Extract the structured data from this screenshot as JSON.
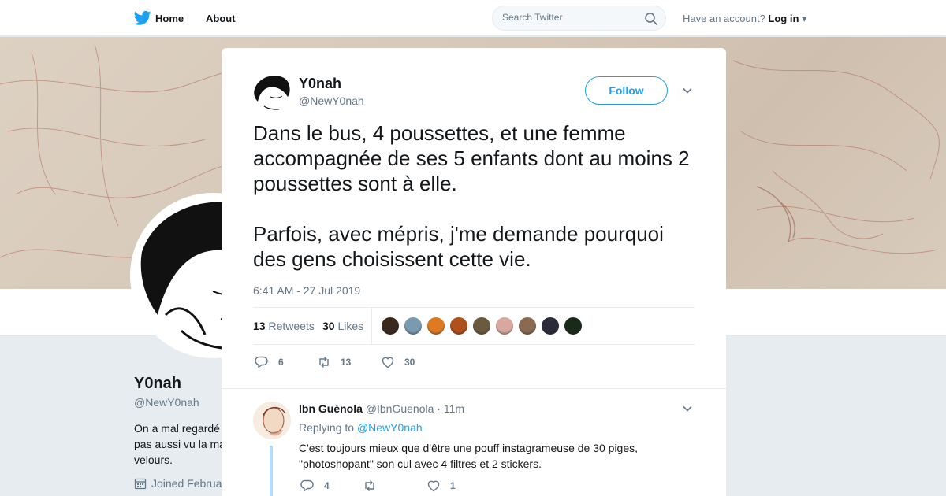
{
  "nav": {
    "home_label": "Home",
    "about_label": "About",
    "search_placeholder": "Search Twitter",
    "account_prompt": "Have an account?",
    "login_label": "Log in",
    "brand_color": "#1da1f2"
  },
  "profile": {
    "name": "Y0nah",
    "handle": "@NewY0nah",
    "bio": "On a mal regardé pas aussi vu la ma velours.",
    "joined": "Joined Februa"
  },
  "tweet": {
    "author_name": "Y0nah",
    "author_handle": "@NewY0nah",
    "follow_label": "Follow",
    "paragraphs": [
      "Dans le bus, 4 poussettes, et une femme accompagnée de ses 5 enfants dont au moins 2 poussettes sont à elle.",
      "Parfois, avec mépris, j'me demande pourquoi des gens choisissent cette vie."
    ],
    "timestamp": "6:41 AM - 27 Jul 2019",
    "retweets_count": "13",
    "retweets_label": "Retweets",
    "likes_count": "30",
    "likes_label": "Likes",
    "liker_colors": [
      "#3a2a1e",
      "#7a9ab0",
      "#e07a20",
      "#b0501a",
      "#6b5a40",
      "#d8a8a0",
      "#8a6a50",
      "#2a2a3a",
      "#1a2a1a"
    ],
    "actions": {
      "replies": "6",
      "retweets": "13",
      "likes": "30"
    }
  },
  "reply": {
    "author_name": "Ibn Guénola",
    "author_handle": "@IbnGuenola",
    "time": "· 11m",
    "replying_prefix": "Replying to",
    "replying_handle": "@NewY0nah",
    "text": "C'est toujours mieux que d'être une pouff instagrameuse de 30 piges, \"photoshopant\" son cul avec 4 filtres et 2 stickers.",
    "replies": "4",
    "retweets": "",
    "likes": "1"
  }
}
